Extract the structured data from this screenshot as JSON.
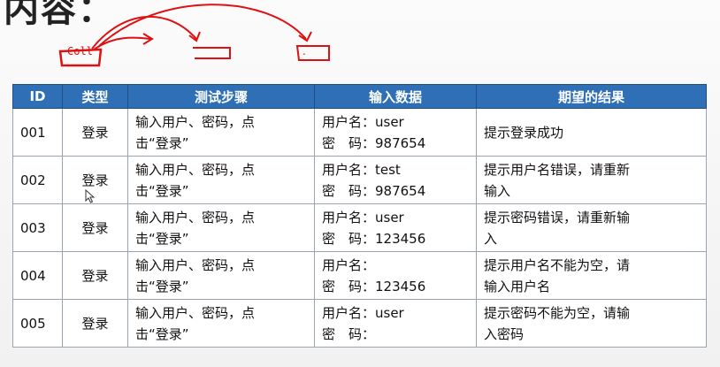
{
  "slide": {
    "title": "内容："
  },
  "annotations": {
    "ink_label": "Coll",
    "ink_dots": "."
  },
  "table": {
    "headers": [
      "ID",
      "类型",
      "测试步骤",
      "输入数据",
      "期望的结果"
    ],
    "rows": [
      {
        "id": "001",
        "type": "登录",
        "steps": [
          "输入用户、密码，点",
          "击“登录”"
        ],
        "input_user": "用户名：user",
        "input_pwd": "密　码：987654",
        "expected": [
          "提示登录成功"
        ]
      },
      {
        "id": "002",
        "type": "登录",
        "steps": [
          "输入用户、密码，点",
          "击“登录”"
        ],
        "input_user": "用户名：test",
        "input_pwd": "密　码：987654",
        "expected": [
          "提示用户名错误，请重新",
          "输入"
        ]
      },
      {
        "id": "003",
        "type": "登录",
        "steps": [
          "输入用户、密码，点",
          "击“登录”"
        ],
        "input_user": "用户名：user",
        "input_pwd": "密　码：123456",
        "expected": [
          "提示密码错误，请重新输",
          "入"
        ]
      },
      {
        "id": "004",
        "type": "登录",
        "steps": [
          "输入用户、密码，点",
          "击“登录”"
        ],
        "input_user": "用户名：",
        "input_pwd": "密　码：123456",
        "expected": [
          "提示用户名不能为空，请",
          "输入用户名"
        ]
      },
      {
        "id": "005",
        "type": "登录",
        "steps": [
          "输入用户、密码，点",
          "击“登录”"
        ],
        "input_user": "用户名：user",
        "input_pwd": "密　码：",
        "expected": [
          "提示密码不能为空，请输",
          "入密码"
        ]
      }
    ]
  },
  "colors": {
    "header_bg": "#2f6fb6",
    "ink": "#d11111"
  },
  "icons": {
    "cursor": "mouse-pointer-icon"
  }
}
